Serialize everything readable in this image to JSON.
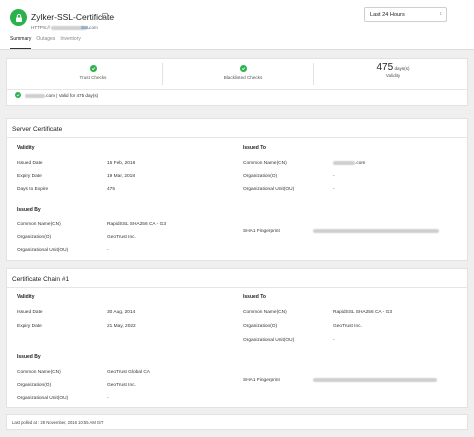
{
  "header": {
    "title": "Zylker-SSL-Certificate",
    "url_prefix": "HTTPS://",
    "url_suffix": ".com",
    "protocol_tag": "SSL",
    "time_range": "Last 24 Hours"
  },
  "tabs": [
    {
      "label": "Summary",
      "active": true
    },
    {
      "label": "Outages",
      "active": false
    },
    {
      "label": "Inventory",
      "active": false
    }
  ],
  "summary": {
    "trust_checks": "Trust Checks",
    "blacklisted_checks": "Blacklisted Checks",
    "days_value": "475",
    "days_unit": "days(s)",
    "validity_label": "Validity",
    "valid_text": ".com | Valid for 475 day(s)"
  },
  "server_certificate": {
    "title": "Server Certificate",
    "validity": {
      "title": "Validity",
      "rows": [
        {
          "label": "Issued Date",
          "value": "15 Feb, 2016"
        },
        {
          "label": "Expiry Date",
          "value": "19 Mar, 2018"
        },
        {
          "label": "Days to Expire",
          "value": "475"
        }
      ]
    },
    "issued_to": {
      "title": "Issued To",
      "rows": [
        {
          "label": "Common Name(CN)",
          "value": ".com"
        },
        {
          "label": "Organization(O)",
          "value": "-"
        },
        {
          "label": "Organizational Unit(OU)",
          "value": "-"
        }
      ]
    },
    "issued_by": {
      "title": "Issued By",
      "rows": [
        {
          "label": "Common Name(CN)",
          "value": "RapidSSL SHA256 CA - G3"
        },
        {
          "label": "Organization(O)",
          "value": "GeoTrust Inc."
        },
        {
          "label": "Organizational Unit(OU)",
          "value": "-"
        }
      ]
    },
    "fingerprint_label": "SHA1 Fingerprint"
  },
  "certificate_chain": {
    "title": "Certificate Chain #1",
    "validity": {
      "title": "Validity",
      "rows": [
        {
          "label": "Issued Date",
          "value": "30 Aug, 2014"
        },
        {
          "label": "Expiry Date",
          "value": "21 May, 2022"
        }
      ]
    },
    "issued_to": {
      "title": "Issued To",
      "rows": [
        {
          "label": "Common Name(CN)",
          "value": "RapidSSL SHA256 CA - G3"
        },
        {
          "label": "Organization(O)",
          "value": "GeoTrust Inc."
        },
        {
          "label": "Organizational Unit(OU)",
          "value": "-"
        }
      ]
    },
    "issued_by": {
      "title": "Issued By",
      "rows": [
        {
          "label": "Common Name(CN)",
          "value": "GeoTrust Global CA"
        },
        {
          "label": "Organization(O)",
          "value": "GeoTrust Inc."
        },
        {
          "label": "Organizational Unit(OU)",
          "value": "-"
        }
      ]
    },
    "fingerprint_label": "SHA1 Fingerprint"
  },
  "footer": {
    "last_polled": "Last polled at : 28 November, 2016 10:55 AM IST"
  },
  "colors": {
    "accent_green": "#2bb24c",
    "link_blue": "#2a6ebb"
  }
}
